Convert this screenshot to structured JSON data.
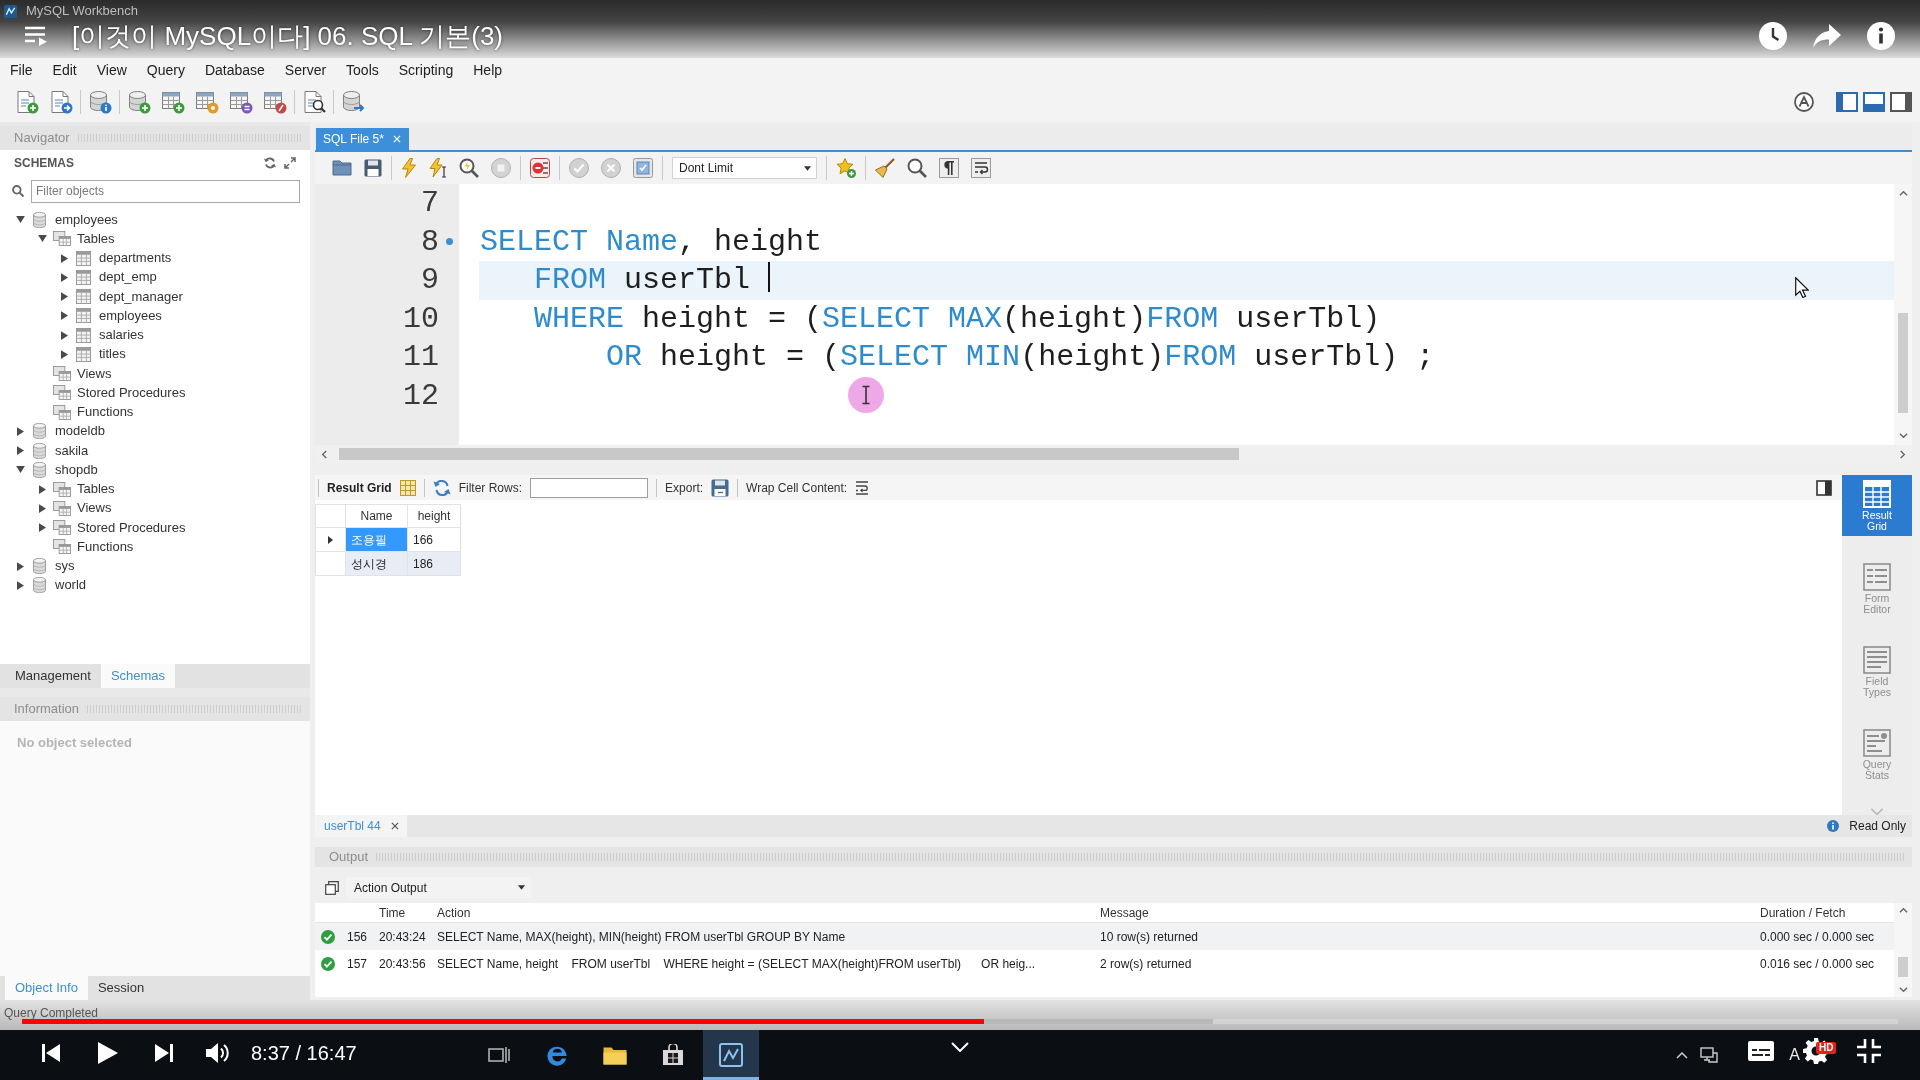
{
  "player": {
    "title": "[이것이 MySQL이다] 06. SQL 기본(3)",
    "time": "8:37 / 16:47",
    "progress": {
      "level": 0.513
    },
    "buffered": {
      "level": 0.635
    },
    "quality_badge": "HD"
  },
  "window": {
    "title": "MySQL Workbench"
  },
  "menu": [
    "File",
    "Edit",
    "View",
    "Query",
    "Database",
    "Server",
    "Tools",
    "Scripting",
    "Help"
  ],
  "navigator": {
    "title": "Navigator",
    "section": "SCHEMAS",
    "filter": {
      "placeholder": "Filter objects"
    },
    "tree": [
      {
        "label": "employees",
        "kind": "schema",
        "expanded": true,
        "children": [
          {
            "label": "Tables",
            "kind": "folder",
            "expanded": true,
            "children": [
              {
                "label": "departments",
                "kind": "table",
                "expanded": false
              },
              {
                "label": "dept_emp",
                "kind": "table",
                "expanded": false
              },
              {
                "label": "dept_manager",
                "kind": "table",
                "expanded": false
              },
              {
                "label": "employees",
                "kind": "table",
                "expanded": false
              },
              {
                "label": "salaries",
                "kind": "table",
                "expanded": false
              },
              {
                "label": "titles",
                "kind": "table",
                "expanded": false
              }
            ]
          },
          {
            "label": "Views",
            "kind": "folder"
          },
          {
            "label": "Stored Procedures",
            "kind": "folder"
          },
          {
            "label": "Functions",
            "kind": "folder"
          }
        ]
      },
      {
        "label": "modeldb",
        "kind": "schema",
        "expanded": false
      },
      {
        "label": "sakila",
        "kind": "schema",
        "expanded": false
      },
      {
        "label": "shopdb",
        "kind": "schema",
        "expanded": true,
        "children": [
          {
            "label": "Tables",
            "kind": "folder",
            "expanded": false
          },
          {
            "label": "Views",
            "kind": "folder",
            "expanded": false
          },
          {
            "label": "Stored Procedures",
            "kind": "folder",
            "expanded": false
          },
          {
            "label": "Functions",
            "kind": "folder"
          }
        ]
      },
      {
        "label": "sys",
        "kind": "schema",
        "expanded": false
      },
      {
        "label": "world",
        "kind": "schema",
        "expanded": false
      }
    ],
    "tabs": [
      {
        "label": "Management",
        "selected": false
      },
      {
        "label": "Schemas",
        "selected": true
      }
    ]
  },
  "information": {
    "title": "Information",
    "message": "No object selected",
    "tabs": [
      {
        "label": "Object Info",
        "selected": true
      },
      {
        "label": "Session",
        "selected": false
      }
    ]
  },
  "editor": {
    "tabs": [
      {
        "label": "SQL File 5*",
        "selected": true
      }
    ],
    "limit": "Dont Limit",
    "lines": [
      {
        "number": "7",
        "current": false,
        "statement_marker": false
      },
      {
        "number": "8",
        "current": false,
        "statement_marker": true,
        "tokens": [
          {
            "kind": "keyword",
            "text": "SELECT Name"
          },
          {
            "kind": "plain",
            "text": ", height"
          }
        ]
      },
      {
        "number": "9",
        "current": true,
        "statement_marker": false,
        "tokens": [
          {
            "kind": "keyword",
            "text": "   FROM"
          },
          {
            "kind": "plain",
            "text": " userTbl "
          }
        ]
      },
      {
        "number": "10",
        "current": false,
        "statement_marker": false,
        "tokens": [
          {
            "kind": "keyword",
            "text": "   WHERE"
          },
          {
            "kind": "plain",
            "text": " height = ("
          },
          {
            "kind": "keyword",
            "text": "SELECT MAX"
          },
          {
            "kind": "plain",
            "text": "(height)"
          },
          {
            "kind": "keyword",
            "text": "FROM"
          },
          {
            "kind": "plain",
            "text": " userTbl)"
          }
        ]
      },
      {
        "number": "11",
        "current": false,
        "statement_marker": false,
        "tokens": [
          {
            "kind": "keyword",
            "text": "       OR"
          },
          {
            "kind": "plain",
            "text": " height = ("
          },
          {
            "kind": "keyword",
            "text": "SELECT MIN"
          },
          {
            "kind": "plain",
            "text": "(height)"
          },
          {
            "kind": "keyword",
            "text": "FROM"
          },
          {
            "kind": "plain",
            "text": " userTbl) ;"
          }
        ]
      },
      {
        "number": "12",
        "current": false,
        "statement_marker": false
      }
    ]
  },
  "results": {
    "toolbar": {
      "title": "Result Grid",
      "filter_label": "Filter Rows:",
      "export_label": "Export:",
      "wrap_label": "Wrap Cell Content:"
    },
    "columns": [
      "Name",
      "height"
    ],
    "rows": [
      {
        "cells": [
          "조용필",
          "166"
        ],
        "selected": true
      },
      {
        "cells": [
          "성시경",
          "186"
        ],
        "selected": false
      }
    ],
    "side_panel": [
      {
        "label": "Result Grid",
        "selected": true
      },
      {
        "label": "Form Editor",
        "selected": false
      },
      {
        "label": "Field Types",
        "selected": false
      },
      {
        "label": "Query Stats",
        "selected": false
      }
    ],
    "tabs": [
      {
        "label": "userTbl 44",
        "selected": true
      }
    ],
    "read_only": "Read Only"
  },
  "output": {
    "title": "Output",
    "mode": "Action Output",
    "columns": [
      "Time",
      "Action",
      "Message",
      "Duration / Fetch"
    ],
    "rows": [
      {
        "success": true,
        "number": "156",
        "time": "20:43:24",
        "action": "SELECT Name, MAX(height), MIN(height) FROM userTbl GROUP BY Name",
        "message": "10 row(s) returned",
        "duration": "0.000 sec / 0.000 sec"
      },
      {
        "success": true,
        "number": "157",
        "time": "20:43:56",
        "action": "SELECT Name, height    FROM userTbl    WHERE height = (SELECT MAX(height)FROM userTbl)      OR heig...",
        "message": "2 row(s) returned",
        "duration": "0.016 sec / 0.000 sec"
      }
    ]
  },
  "status_bar": "Query Completed",
  "taskbar": {
    "input_indicator": "A"
  }
}
